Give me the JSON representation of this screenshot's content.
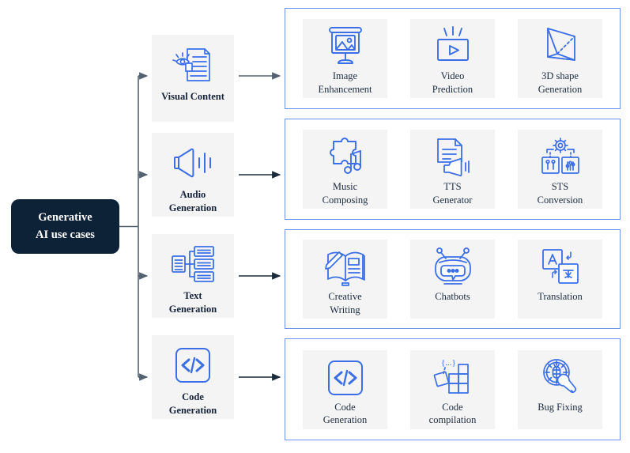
{
  "root": {
    "line1": "Generative",
    "line2": "AI use cases"
  },
  "colors": {
    "root_bg": "#0d2137",
    "root_text": "#ffffff",
    "group_border": "#6d93ef",
    "card_bg": "#f4f4f4",
    "icon_blue": "#3b6fe8",
    "connector": "#3d4a57",
    "page_bg": "#ffffff"
  },
  "categories": [
    {
      "label": "Visual Content",
      "line1": "Visual Content",
      "line2": "",
      "icon": "document-eye-icon"
    },
    {
      "label": "Audio Generation",
      "line1": "Audio",
      "line2": "Generation",
      "icon": "speaker-waves-icon"
    },
    {
      "label": "Text Generation",
      "line1": "Text",
      "line2": "Generation",
      "icon": "text-tree-icon"
    },
    {
      "label": "Code Generation",
      "line1": "Code",
      "line2": "Generation",
      "icon": "code-brackets-icon"
    }
  ],
  "groups": [
    {
      "category": "Visual Content",
      "cards": [
        {
          "line1": "Image",
          "line2": "Enhancement",
          "icon": "presentation-image-icon"
        },
        {
          "line1": "Video",
          "line2": "Prediction",
          "icon": "video-play-icon"
        },
        {
          "line1": "3D shape",
          "line2": "Generation",
          "icon": "prism-3d-icon"
        }
      ]
    },
    {
      "category": "Audio Generation",
      "cards": [
        {
          "line1": "Music",
          "line2": "Composing",
          "icon": "puzzle-music-icon"
        },
        {
          "line1": "TTS",
          "line2": "Generator",
          "icon": "document-speaker-icon"
        },
        {
          "line1": "STS",
          "line2": "Conversion",
          "icon": "gear-voice-panels-icon"
        }
      ]
    },
    {
      "category": "Text Generation",
      "cards": [
        {
          "line1": "Creative",
          "line2": "Writing",
          "icon": "book-pencil-icon"
        },
        {
          "line1": "Chatbots",
          "line2": "",
          "icon": "robot-chat-icon"
        },
        {
          "line1": "Translation",
          "line2": "",
          "icon": "translate-cards-icon"
        }
      ]
    },
    {
      "category": "Code Generation",
      "cards": [
        {
          "line1": "Code",
          "line2": "Generation",
          "icon": "code-brackets-icon"
        },
        {
          "line1": "Code",
          "line2": "compilation",
          "icon": "code-blocks-icon"
        },
        {
          "line1": "Bug Fixing",
          "line2": "",
          "icon": "bug-wrench-icon"
        }
      ]
    }
  ]
}
